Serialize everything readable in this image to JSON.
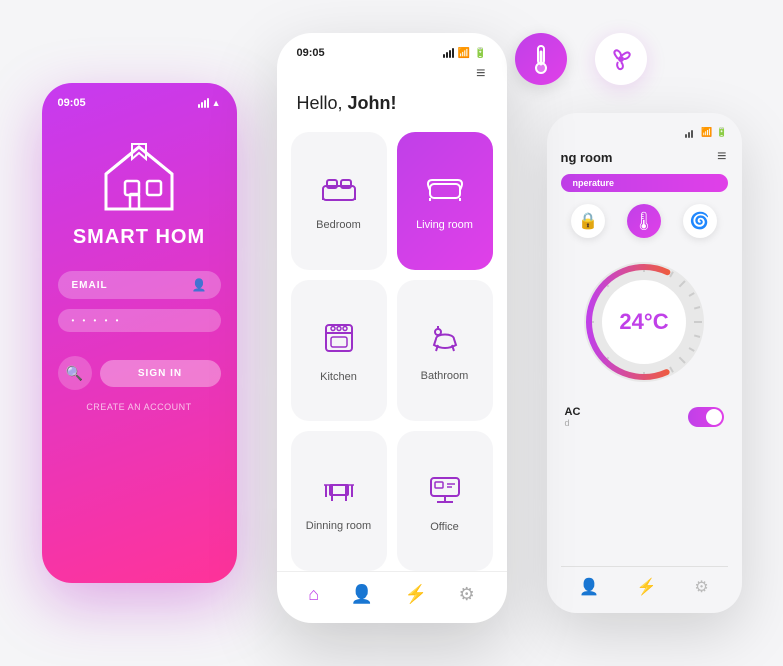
{
  "left_phone": {
    "time": "09:05",
    "brand": "SMART HOM",
    "email_label": "EMAIL",
    "password_dots": "• • • • •",
    "sign_in": "SIGN IN",
    "create_account": "CREATE AN ACCOUNT"
  },
  "center_phone": {
    "time": "09:05",
    "greeting": "Hello, ",
    "name": "John!",
    "rooms": [
      {
        "label": "Bedroom",
        "active": false,
        "icon": "🛏"
      },
      {
        "label": "Living room",
        "active": true,
        "icon": "🛋"
      },
      {
        "label": "Kitchen",
        "active": false,
        "icon": "🍳"
      },
      {
        "label": "Bathroom",
        "active": false,
        "icon": "🛁"
      },
      {
        "label": "Dinning room",
        "active": false,
        "icon": "🪑"
      },
      {
        "label": "Office",
        "active": false,
        "icon": "🖥"
      }
    ]
  },
  "right_phone": {
    "room": "ng room",
    "badge": "nperature",
    "temperature": "24°C",
    "ac_label": "AC",
    "ac_sub": "d"
  },
  "float_icons": {
    "temp": "🌡",
    "fan": "⚙"
  }
}
